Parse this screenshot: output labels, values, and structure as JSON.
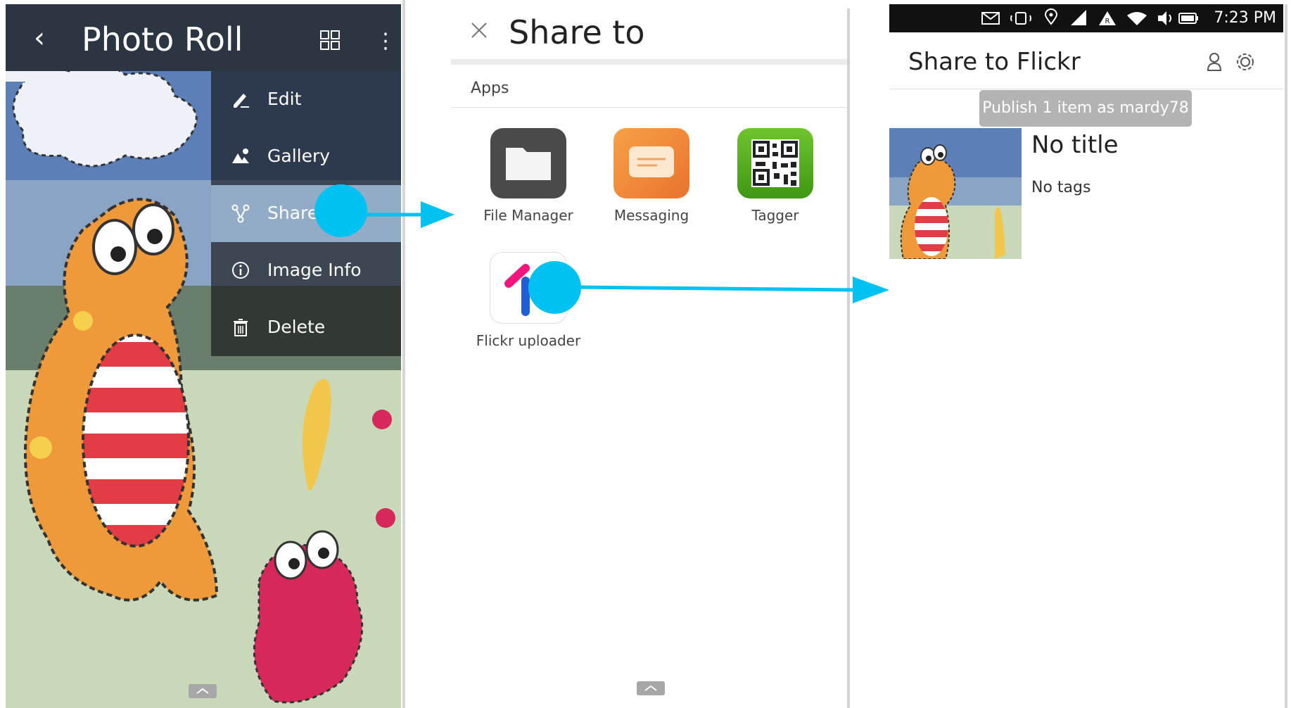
{
  "photo_roll": {
    "back_icon": "chevron-left-icon",
    "title": "Photo Roll",
    "grid_icon": "grid-view-icon",
    "more_icon": "overflow-menu-icon",
    "menu": [
      {
        "label": "Edit",
        "icon": "edit-icon"
      },
      {
        "label": "Gallery",
        "icon": "gallery-icon"
      },
      {
        "label": "Share",
        "icon": "share-icon",
        "active": true
      },
      {
        "label": "Image Info",
        "icon": "info-icon"
      },
      {
        "label": "Delete",
        "icon": "delete-icon"
      }
    ]
  },
  "share_to": {
    "close_icon": "close-icon",
    "title": "Share to",
    "section": "Apps",
    "apps": [
      {
        "label": "File Manager",
        "icon": "file-manager-icon"
      },
      {
        "label": "Messaging",
        "icon": "messaging-icon"
      },
      {
        "label": "Tagger",
        "icon": "qr-code-icon"
      },
      {
        "label": "Flickr uploader",
        "icon": "flickr-uploader-icon"
      }
    ]
  },
  "share_to_flickr": {
    "status_bar": {
      "time": "7:23 PM",
      "icons": [
        "mail-icon",
        "rotation-lock-icon",
        "location-icon",
        "signal-icon",
        "roaming-icon",
        "wifi-icon",
        "volume-icon",
        "battery-icon"
      ]
    },
    "title": "Share to Flickr",
    "account_icon": "account-icon",
    "settings_icon": "settings-gear-icon",
    "publish_label": "Publish 1 item as mardy78",
    "item_title": "No title",
    "item_tags": "No tags"
  },
  "colors": {
    "tap_indicator": "#00c2f2",
    "active_menu": "#96afc8",
    "status_bar": "#111111"
  }
}
